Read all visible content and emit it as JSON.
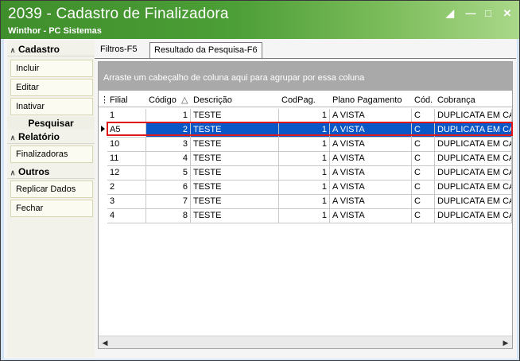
{
  "window": {
    "title": "2039 - Cadastro de Finalizadora",
    "subtitle": "Winthor - PC Sistemas",
    "controls": [
      "restore-icon",
      "minimize-icon",
      "maximize-icon",
      "close-icon"
    ]
  },
  "sidebar": {
    "cadastro_title": "Cadastro",
    "incluir": "Incluir",
    "editar": "Editar",
    "inativar": "Inativar",
    "pesquisar": "Pesquisar",
    "relatorio_title": "Relatório",
    "finalizadoras": "Finalizadoras",
    "outros_title": "Outros",
    "replicar": "Replicar Dados",
    "fechar": "Fechar"
  },
  "tabs": {
    "filtros": "Filtros-F5",
    "resultado": "Resultado da Pesquisa-F6"
  },
  "grid": {
    "group_hint": "Arraste um cabeçalho de coluna aqui para agrupar por essa coluna",
    "columns": {
      "filial": "Filial",
      "codigo": "Código",
      "descricao": "Descrição",
      "codpag": "CodPag.",
      "plano": "Plano Pagamento",
      "cod": "Cód.",
      "cobranca": "Cobrança"
    },
    "sort_indicator": "△",
    "rows": [
      {
        "filial": "1",
        "codigo": "1",
        "descricao": "TESTE",
        "codpag": "1",
        "plano": "A VISTA",
        "cod": "C",
        "cobranca": "DUPLICATA EM CARTEIRA"
      },
      {
        "filial": "A5",
        "codigo": "2",
        "descricao": "TESTE",
        "codpag": "1",
        "plano": "A VISTA",
        "cod": "C",
        "cobranca": "DUPLICATA EM CARTEIRA"
      },
      {
        "filial": "10",
        "codigo": "3",
        "descricao": "TESTE",
        "codpag": "1",
        "plano": "A VISTA",
        "cod": "C",
        "cobranca": "DUPLICATA EM CARTEIRA"
      },
      {
        "filial": "11",
        "codigo": "4",
        "descricao": "TESTE",
        "codpag": "1",
        "plano": "A VISTA",
        "cod": "C",
        "cobranca": "DUPLICATA EM CARTEIRA"
      },
      {
        "filial": "12",
        "codigo": "5",
        "descricao": "TESTE",
        "codpag": "1",
        "plano": "A VISTA",
        "cod": "C",
        "cobranca": "DUPLICATA EM CARTEIRA"
      },
      {
        "filial": "2",
        "codigo": "6",
        "descricao": "TESTE",
        "codpag": "1",
        "plano": "A VISTA",
        "cod": "C",
        "cobranca": "DUPLICATA EM CARTEIRA"
      },
      {
        "filial": "3",
        "codigo": "7",
        "descricao": "TESTE",
        "codpag": "1",
        "plano": "A VISTA",
        "cod": "C",
        "cobranca": "DUPLICATA EM CARTEIRA"
      },
      {
        "filial": "4",
        "codigo": "8",
        "descricao": "TESTE",
        "codpag": "1",
        "plano": "A VISTA",
        "cod": "C",
        "cobranca": "DUPLICATA EM CARTEIRA"
      }
    ],
    "selected_row": 1
  },
  "colors": {
    "title_green": "#4c9e36",
    "selection_blue": "#0a57c7",
    "highlight_red": "#e01818"
  }
}
